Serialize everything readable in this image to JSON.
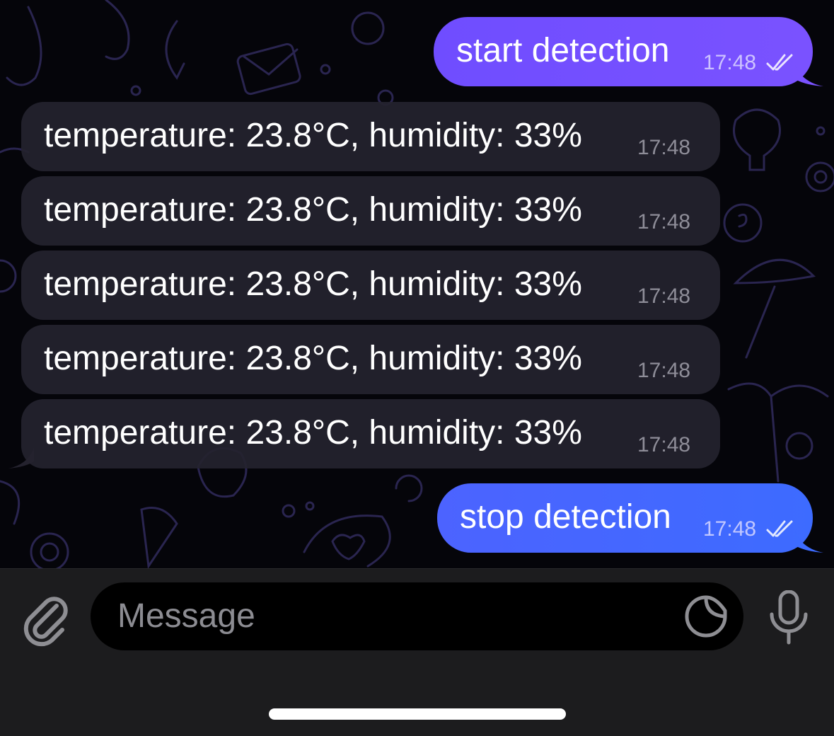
{
  "conversation": {
    "sent_start": {
      "text": "start detection",
      "time": "17:48",
      "status": "read"
    },
    "readings": [
      {
        "text": "temperature: 23.8°C, humidity: 33%",
        "time": "17:48"
      },
      {
        "text": "temperature: 23.8°C, humidity: 33%",
        "time": "17:48"
      },
      {
        "text": "temperature: 23.8°C, humidity: 33%",
        "time": "17:48"
      },
      {
        "text": "temperature: 23.8°C, humidity: 33%",
        "time": "17:48"
      },
      {
        "text": "temperature: 23.8°C, humidity: 33%",
        "time": "17:48"
      }
    ],
    "sent_stop": {
      "text": "stop detection",
      "time": "17:48",
      "status": "read"
    }
  },
  "composer": {
    "placeholder": "Message",
    "icons": {
      "attach": "paperclip-icon",
      "sticker": "sticker-icon",
      "voice": "microphone-icon"
    }
  },
  "colors": {
    "outgoing_start": "#7652ff",
    "outgoing_stop": "#4566ff",
    "incoming": "#24222e",
    "composer_bg": "#1c1c1e"
  }
}
